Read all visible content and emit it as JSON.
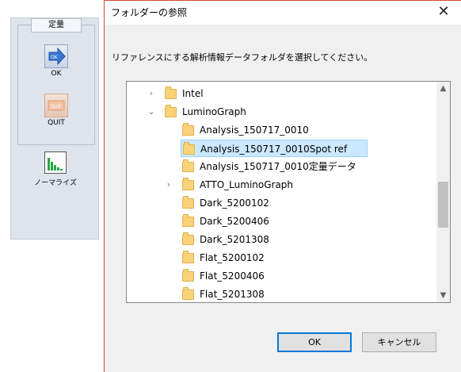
{
  "app": {
    "group_label": "定量",
    "ok_label": "OK",
    "ok_icon_text": "OK",
    "quit_label": "QUIT",
    "quit_icon_text": "Quit",
    "normalize_label": "ノーマライズ"
  },
  "dialog": {
    "title": "フォルダーの参照",
    "close_glyph": "✕",
    "instruction": "リファレンスにする解析情報データフォルダを選択してください。",
    "tree": [
      {
        "label": "Intel",
        "expander": "›",
        "selected": false
      },
      {
        "label": "LuminoGraph",
        "expander": "⌄",
        "selected": false
      },
      {
        "label": "Analysis_150717_0010",
        "expander": "",
        "selected": false
      },
      {
        "label": "Analysis_150717_0010Spot ref",
        "expander": "",
        "selected": true
      },
      {
        "label": "Analysis_150717_0010定量データ",
        "expander": "",
        "selected": false
      },
      {
        "label": "ATTO_LuminoGraph",
        "expander": "›",
        "selected": false
      },
      {
        "label": "Dark_5200102",
        "expander": "",
        "selected": false
      },
      {
        "label": "Dark_5200406",
        "expander": "",
        "selected": false
      },
      {
        "label": "Dark_5201308",
        "expander": "",
        "selected": false
      },
      {
        "label": "Flat_5200102",
        "expander": "",
        "selected": false
      },
      {
        "label": "Flat_5200406",
        "expander": "",
        "selected": false
      },
      {
        "label": "Flat_5201308",
        "expander": "",
        "selected": false
      }
    ],
    "scroll_up_glyph": "▲",
    "scroll_down_glyph": "▼",
    "ok_button": "OK",
    "cancel_button": "キャンセル"
  },
  "colors": {
    "selection_bg": "#cce8ff",
    "selection_border": "#99d1ff",
    "default_button_border": "#0078d7",
    "folder": "#f9d27a",
    "dialog_border": "#d14b3b"
  }
}
